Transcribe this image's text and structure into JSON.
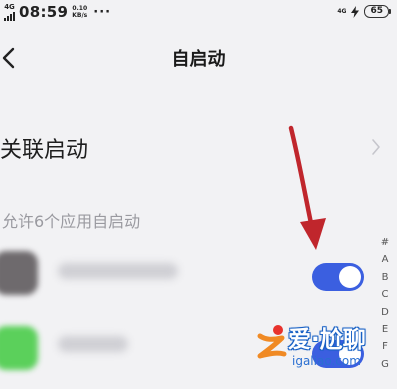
{
  "status_bar": {
    "network_type": "4G",
    "time": "08:59",
    "speed_value": "0.10",
    "speed_unit": "KB/s",
    "more_indicator": "···",
    "network_small": "4G",
    "battery_level": "65"
  },
  "header": {
    "title": "自启动",
    "back_icon": "chevron-left-icon"
  },
  "related_start": {
    "label": "关联启动",
    "chevron_icon": "chevron-right-icon"
  },
  "app_list": {
    "section_title": "允许6个应用自启动",
    "apps": [
      {
        "name": "",
        "icon_color": "#6e6a6d",
        "enabled": true
      },
      {
        "name": "",
        "icon_color": "#5bd05b",
        "enabled": true
      }
    ],
    "toggle_color": "#3b5fe0"
  },
  "alpha_index": [
    "#",
    "A",
    "B",
    "C",
    "D",
    "E",
    "F",
    "G"
  ],
  "annotation": {
    "arrow_color": "#c0262c"
  },
  "watermark": {
    "title": "爱·尬聊",
    "domain": "igaliao.com"
  }
}
